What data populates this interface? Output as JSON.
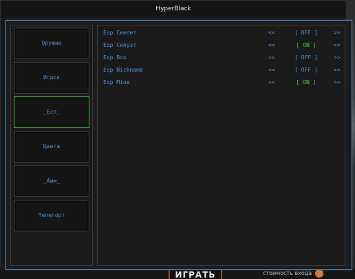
{
  "window": {
    "title": "HyperBlack"
  },
  "sidebar": {
    "items": [
      {
        "label": "Оружие",
        "active": false
      },
      {
        "label": "Игрок",
        "active": false
      },
      {
        "label": "_Есп_",
        "active": true
      },
      {
        "label": "Цвета",
        "active": false
      },
      {
        "label": "_Аим_",
        "active": false
      },
      {
        "label": "Телепорт",
        "active": false
      }
    ]
  },
  "esp": {
    "prev_label": "<<",
    "next_label": ">>",
    "rows": [
      {
        "label": "Esp Скелет",
        "state": "[ OFF ]"
      },
      {
        "label": "Esp Силуэт",
        "state": "[ ON ]"
      },
      {
        "label": "Esp Box",
        "state": "[ OFF ]"
      },
      {
        "label": "Esp Nickname",
        "state": "[ OFF ]"
      },
      {
        "label": "Esp Mine",
        "state": "[ ON ]"
      }
    ]
  },
  "background": {
    "play_button": "ИГРАТЬ",
    "cost_label": "стоимость входа"
  },
  "colors": {
    "accent_blue": "#4f95d1",
    "on_green": "#46d13f",
    "frame_border": "#4a8fc6"
  }
}
